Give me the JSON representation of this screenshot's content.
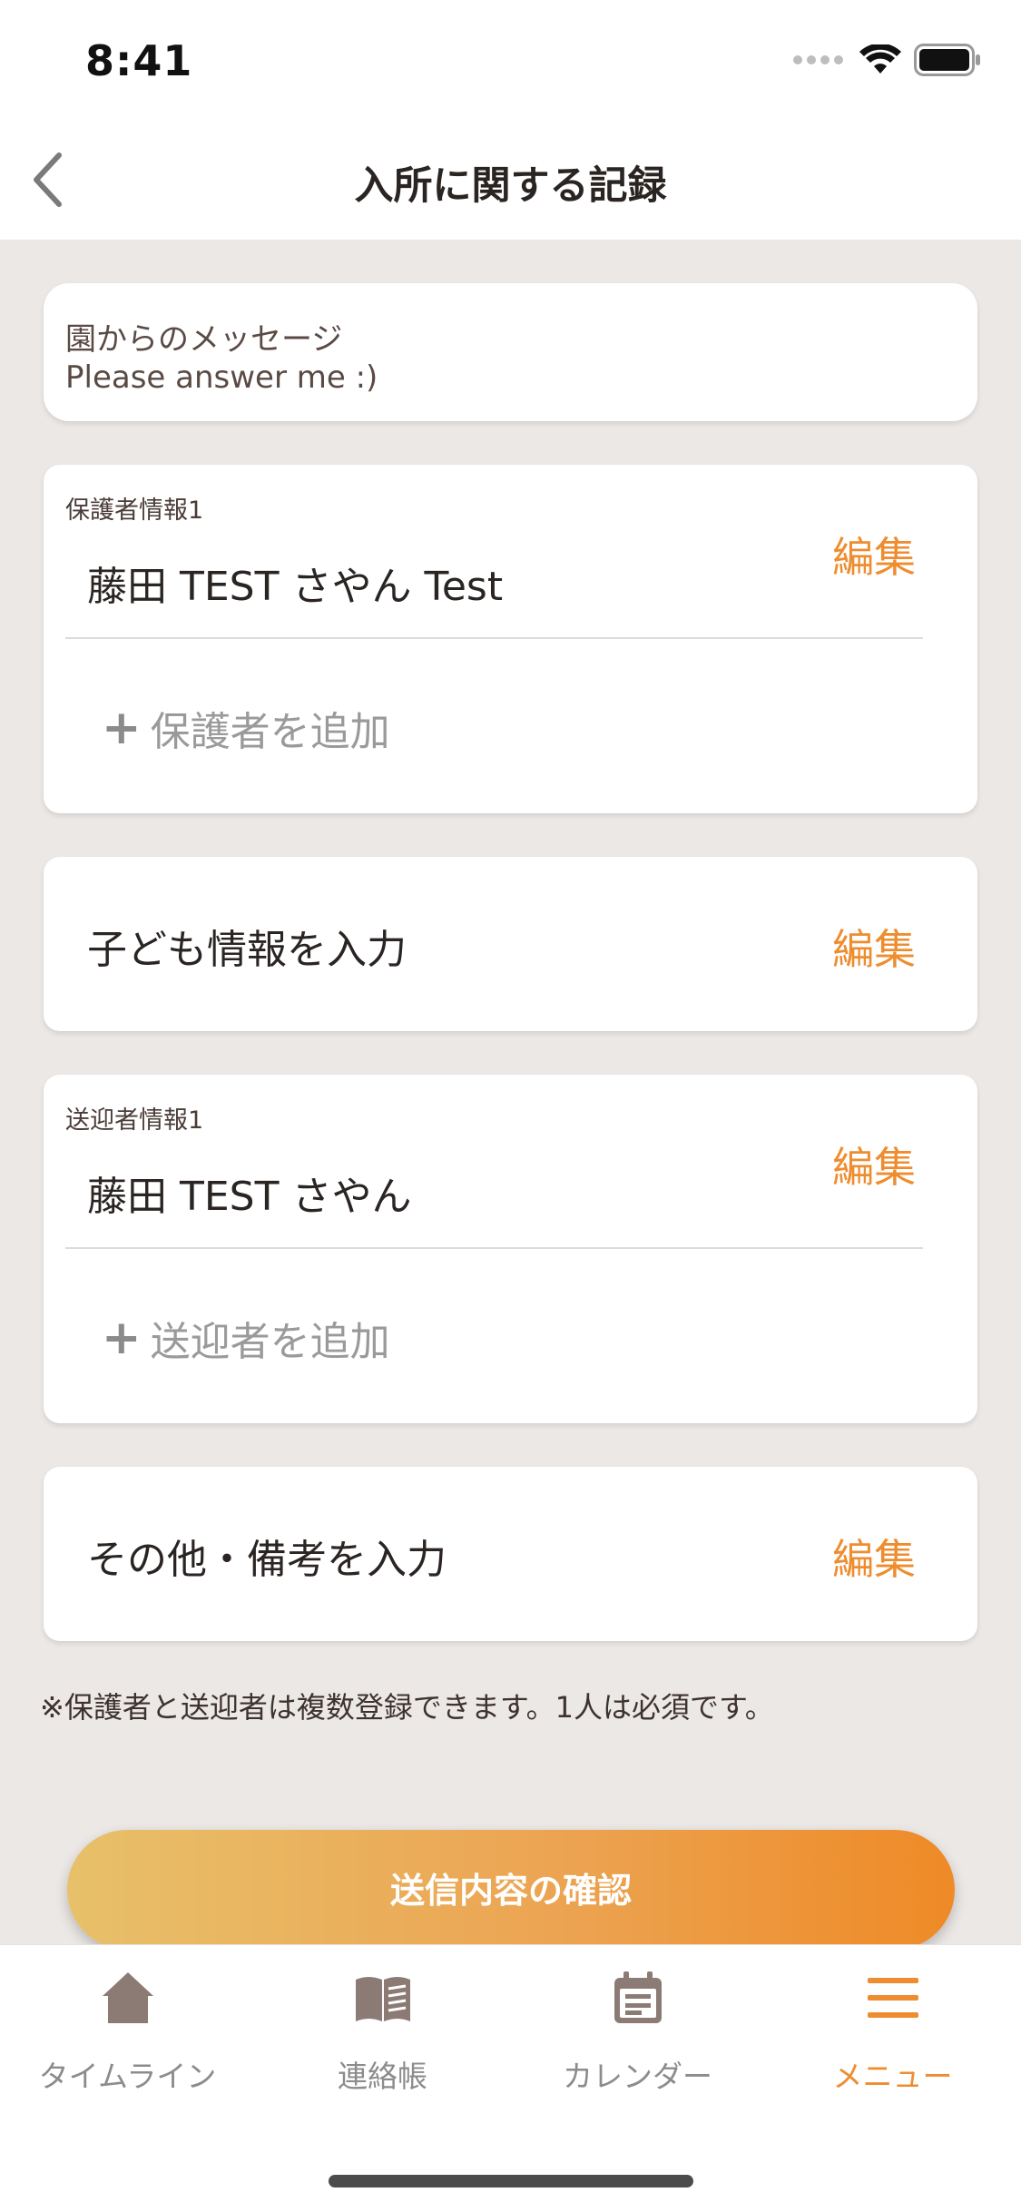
{
  "status_bar": {
    "time": "8:41"
  },
  "header": {
    "title": "入所に関する記録",
    "back_icon": "chevron-left-icon"
  },
  "message": {
    "label": "園からのメッセージ",
    "text": "Please answer me :)"
  },
  "guardian": {
    "section_label": "保護者情報1",
    "name": "藤田 TEST さやん Test",
    "edit_label": "編集",
    "add_label": "保護者を追加",
    "add_symbol": "+"
  },
  "child": {
    "title": "子ども情報を入力",
    "edit_label": "編集"
  },
  "pickup": {
    "section_label": "送迎者情報1",
    "name": "藤田 TEST さやん",
    "edit_label": "編集",
    "add_label": "送迎者を追加",
    "add_symbol": "+"
  },
  "other": {
    "title": "その他・備考を入力",
    "edit_label": "編集"
  },
  "note": "※保護者と送迎者は複数登録できます。1人は必須です。",
  "confirm_button": {
    "label": "送信内容の確認"
  },
  "tab_bar": {
    "tabs": [
      {
        "label": "タイムライン",
        "icon": "home-icon",
        "active": false
      },
      {
        "label": "連絡帳",
        "icon": "book-icon",
        "active": false
      },
      {
        "label": "カレンダー",
        "icon": "calendar-icon",
        "active": false
      },
      {
        "label": "メニュー",
        "icon": "menu-icon",
        "active": true
      }
    ]
  },
  "colors": {
    "accent": "#EE8D2F",
    "background": "#ECE8E6",
    "inactive_tab": "#8C8C8C"
  }
}
